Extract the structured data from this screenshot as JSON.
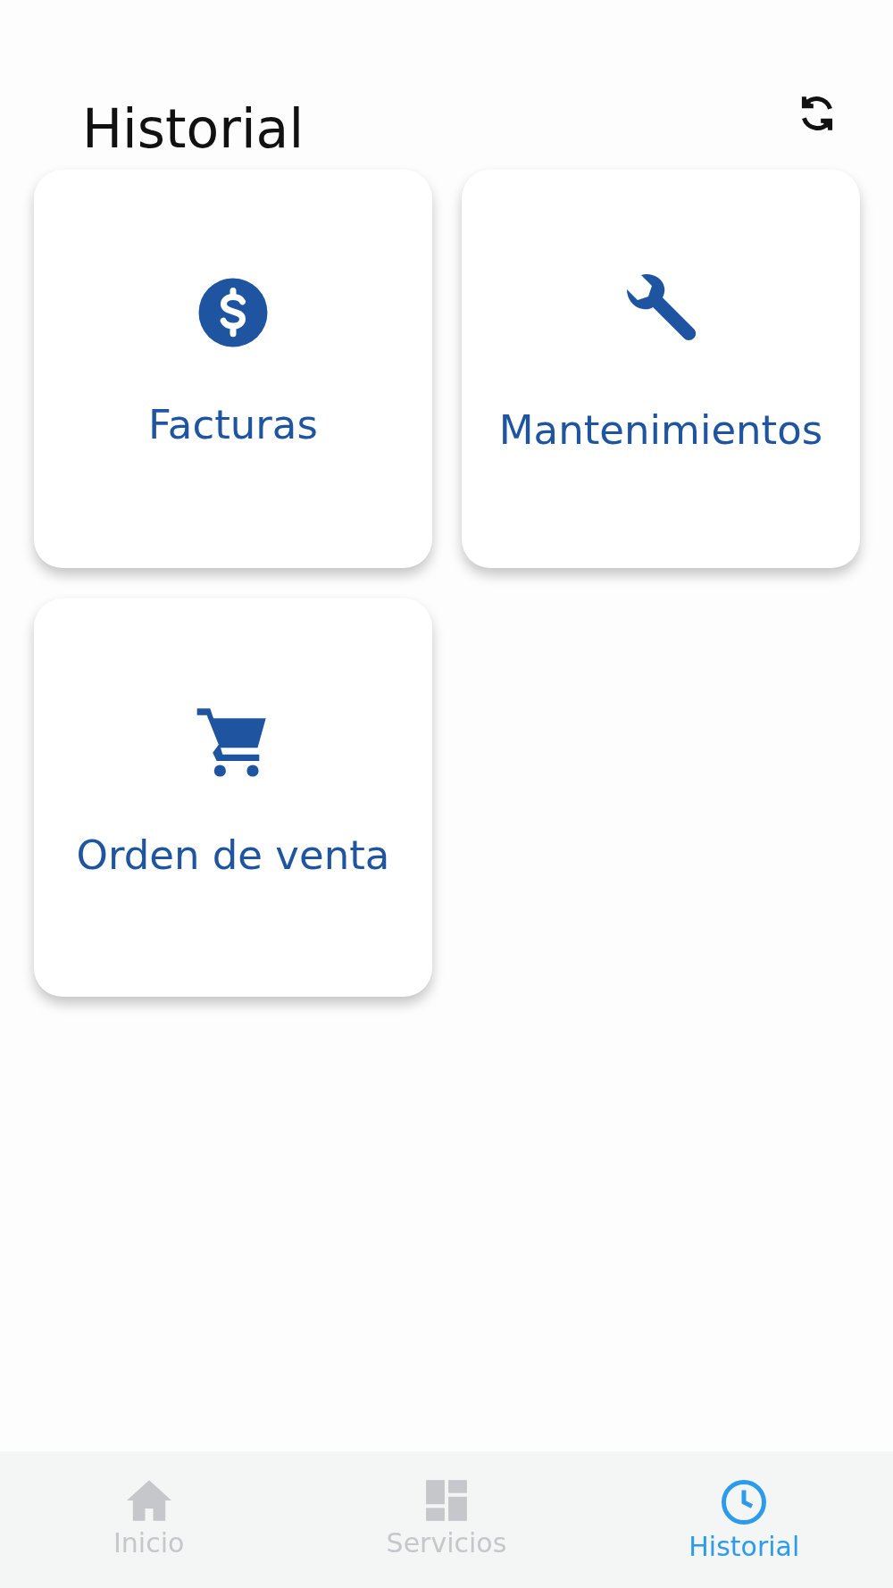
{
  "header": {
    "title": "Historial"
  },
  "cards": [
    {
      "kind": "dollar",
      "label": "Facturas"
    },
    {
      "kind": "wrench",
      "label": "Mantenimientos"
    },
    {
      "kind": "cart",
      "label": "Orden de venta"
    }
  ],
  "tabbar": [
    {
      "kind": "home",
      "label": "Inicio",
      "selected": false
    },
    {
      "kind": "grid",
      "label": "Servicios",
      "selected": false
    },
    {
      "kind": "clock",
      "label": "Historial",
      "selected": true
    }
  ]
}
